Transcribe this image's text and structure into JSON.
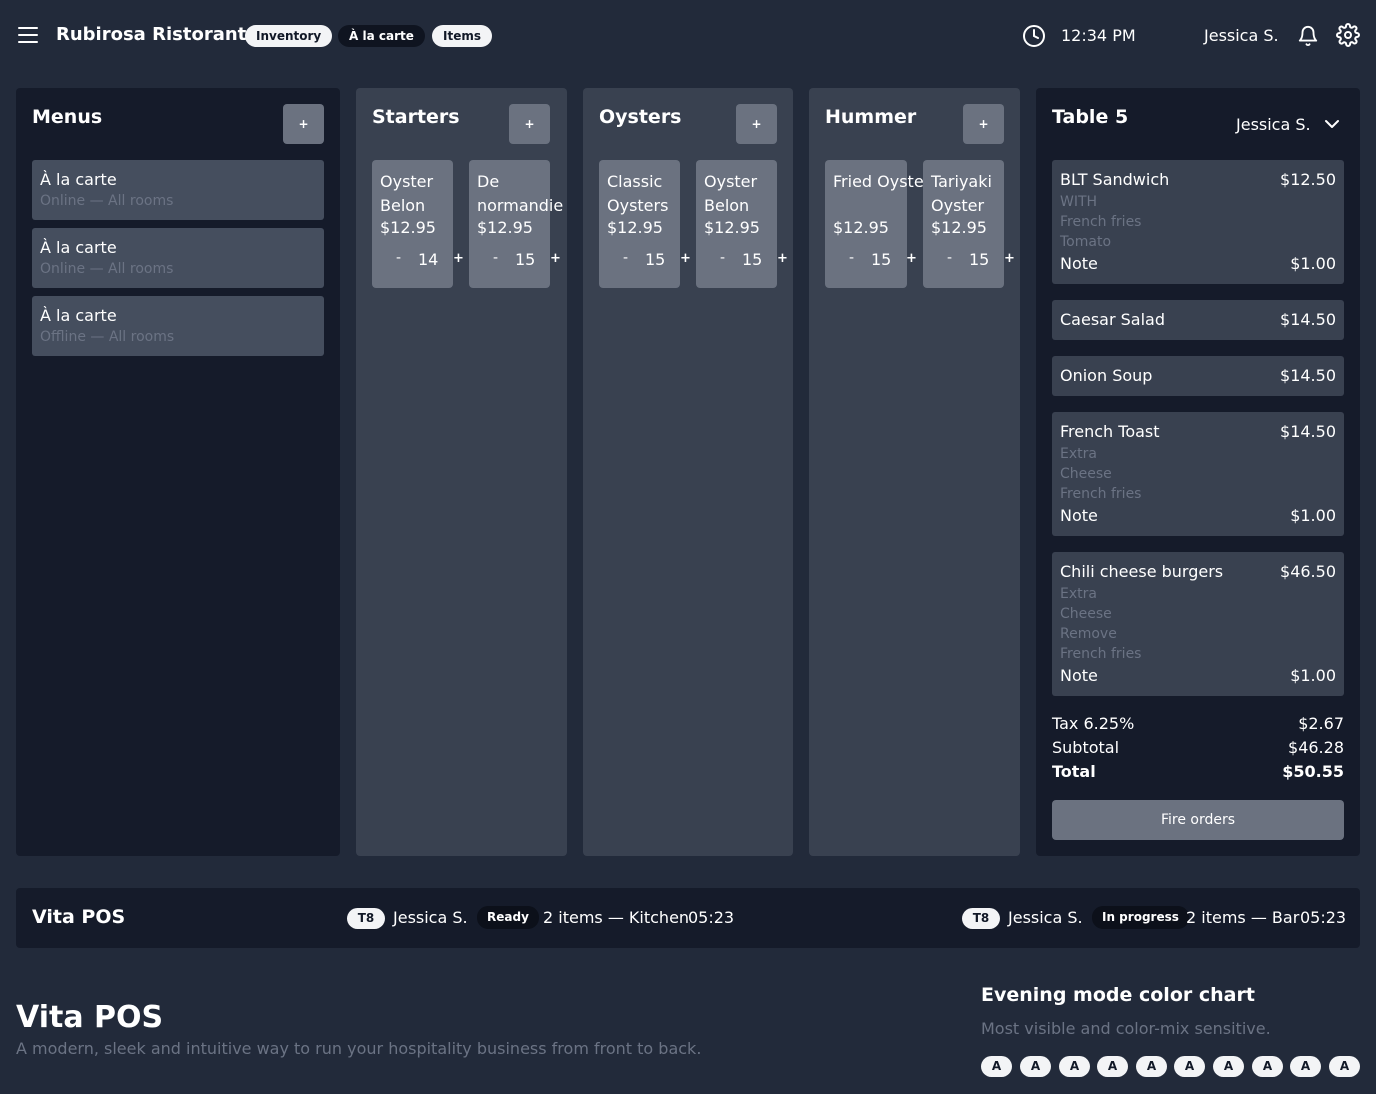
{
  "header": {
    "brand": "Rubirosa Ristorante",
    "pills": [
      "Inventory",
      "À la carte",
      "Items"
    ],
    "time": "12:34 PM",
    "user": "Jessica S."
  },
  "menus": {
    "title": "Menus",
    "add": "+",
    "items": [
      {
        "title": "À la carte",
        "sub": "Online — All rooms"
      },
      {
        "title": "À la carte",
        "sub": "Online — All rooms"
      },
      {
        "title": "À la carte",
        "sub": "Offline — All rooms"
      }
    ]
  },
  "categories": [
    {
      "title": "Starters",
      "add": "+",
      "items": [
        {
          "name": "Oyster Belon",
          "price": "$12.95",
          "minus": "-",
          "qty": "14",
          "plus": "+"
        },
        {
          "name": "De normandie",
          "price": "$12.95",
          "minus": "-",
          "qty": "15",
          "plus": "+"
        }
      ]
    },
    {
      "title": "Oysters",
      "add": "+",
      "items": [
        {
          "name": "Classic Oysters",
          "price": "$12.95",
          "minus": "-",
          "qty": "15",
          "plus": "+"
        },
        {
          "name": "Oyster Belon",
          "price": "$12.95",
          "minus": "-",
          "qty": "15",
          "plus": "+"
        }
      ]
    },
    {
      "title": "Hummer",
      "add": "+",
      "items": [
        {
          "name": "Fried Oyster",
          "price": "$12.95",
          "minus": "-",
          "qty": "15",
          "plus": "+"
        },
        {
          "name": "Tariyaki Oyster",
          "price": "$12.95",
          "minus": "-",
          "qty": "15",
          "plus": "+"
        }
      ]
    }
  ],
  "table": {
    "title": "Table 5",
    "user": "Jessica S.",
    "orders": [
      {
        "name": "BLT Sandwich",
        "price": "$12.50",
        "mods": [
          "WITH",
          "French fries",
          "Tomato"
        ],
        "note": "Note",
        "note_price": "$1.00"
      },
      {
        "name": "Caesar Salad",
        "price": "$14.50"
      },
      {
        "name": "Onion Soup",
        "price": "$14.50"
      },
      {
        "name": "French Toast",
        "price": "$14.50",
        "mods": [
          "Extra",
          "Cheese",
          "French fries"
        ],
        "note": "Note",
        "note_price": "$1.00"
      },
      {
        "name": "Chili cheese burgers",
        "price": "$46.50",
        "mods": [
          "Extra",
          "Cheese",
          "Remove",
          "French fries"
        ],
        "note": "Note",
        "note_price": "$1.00"
      }
    ],
    "tax_label": "Tax 6.25%",
    "tax": "$2.67",
    "subtotal_label": "Subtotal",
    "subtotal": "$46.28",
    "total_label": "Total",
    "total": "$50.55",
    "fire": "Fire orders"
  },
  "bottom_bar": {
    "title": "Vita POS",
    "tickets": [
      {
        "tag": "T8",
        "user": "Jessica S.",
        "status": "Ready",
        "info": "2 items — Kitchen",
        "time": "05:23"
      },
      {
        "tag": "T8",
        "user": "Jessica S.",
        "status": "In progress",
        "info": "2 items — Bar",
        "time": "05:23"
      }
    ]
  },
  "footer": {
    "title": "Vita POS",
    "subtitle": "A modern, sleek and intuitive way to run your hospitality business from front to back.",
    "chart_title": "Evening mode color chart",
    "chart_sub": "Most visible and color-mix sensitive.",
    "swatches": [
      "A",
      "A",
      "A",
      "A",
      "A",
      "A",
      "A",
      "A",
      "A",
      "A"
    ]
  }
}
